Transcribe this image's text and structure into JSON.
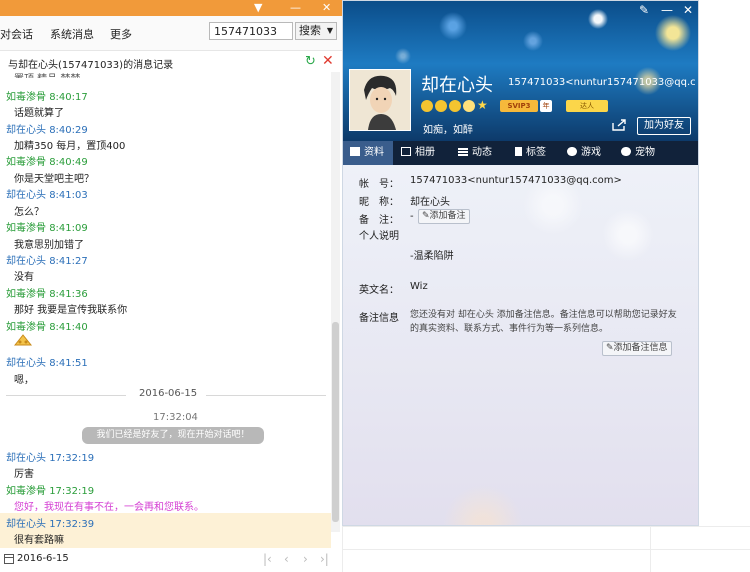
{
  "left_panel": {
    "menu": [
      "对会话",
      "系统消息",
      "更多"
    ],
    "search": {
      "value": "157471033",
      "button": "搜索"
    },
    "history_title": "与却在心头(157471033)的消息记录",
    "top_partial": "置顶 精品 梦梦",
    "messages": [
      {
        "sender": "如毒渗骨",
        "time": "8:40:17",
        "text": "话题就算了",
        "me": true
      },
      {
        "sender": "却在心头",
        "time": "8:40:29",
        "text": "加精350 每月，置顶400",
        "me": false
      },
      {
        "sender": "如毒渗骨",
        "time": "8:40:49",
        "text": "你是天堂吧主吧？",
        "me": true
      },
      {
        "sender": "却在心头",
        "time": "8:41:03",
        "text": "怎么？",
        "me": false
      },
      {
        "sender": "如毒渗骨",
        "time": "8:41:09",
        "text": "我意思别加错了",
        "me": true
      },
      {
        "sender": "却在心头",
        "time": "8:41:27",
        "text": "没有",
        "me": false
      },
      {
        "sender": "如毒渗骨",
        "time": "8:41:36",
        "text": "那好 我要是宣传我联系你",
        "me": true
      },
      {
        "sender": "如毒渗骨",
        "time": "8:41:40",
        "text": "",
        "me": true
      },
      {
        "sender": "却在心头",
        "time": "8:41:51",
        "text": "嗯，",
        "me": false
      }
    ],
    "date_separator": "2016-06-15",
    "system_time": "17:32:04",
    "system_message": "我们已经是好友了，现在开始对话吧！",
    "messages2": [
      {
        "sender": "却在心头",
        "time": "17:32:19",
        "text": "厉害",
        "me": false
      },
      {
        "sender": "如毒渗骨",
        "time": "17:32:19",
        "text": "您好，我现在有事不在，一会再和您联系。",
        "me": true
      },
      {
        "sender": "却在心头",
        "time": "17:32:39",
        "text": "很有套路嘛",
        "me": false
      }
    ],
    "bottom_date": "2016-6-15"
  },
  "profile": {
    "nickname": "却在心头",
    "account_header": "157471033<nuntur157471033@qq.c",
    "vip_label": "SVIP3",
    "vip_num": "年",
    "xinren_label": "达人",
    "signature": "如痴，如醉",
    "add_friend": "加为好友",
    "tabs": [
      "资料",
      "相册",
      "动态",
      "标签",
      "游戏",
      "宠物"
    ],
    "fields": {
      "account_label": "帐　号：",
      "account_value": "157471033<nuntur157471033@qq.com>",
      "nick_label": "昵　称：",
      "nick_value": "却在心头",
      "remark_label": "备　注：",
      "remark_value": "-",
      "add_remark": "添加备注",
      "intro_label": "个人说明",
      "intro_value": "-温柔陷阱",
      "en_label": "英文名：",
      "en_value": "Wiz",
      "note_label": "备注信息",
      "note_text": "您还没有对 却在心头 添加备注信息。备注信息可以帮助您记录好友的真实资料、联系方式、事件行为等一系列信息。",
      "add_note_info": "添加备注信息"
    }
  },
  "colors": {
    "orange_bar": "#f19a3a",
    "me_sender": "#2a9d3a",
    "other_sender": "#2b6fb8",
    "auto_reply": "#d43fd3"
  }
}
